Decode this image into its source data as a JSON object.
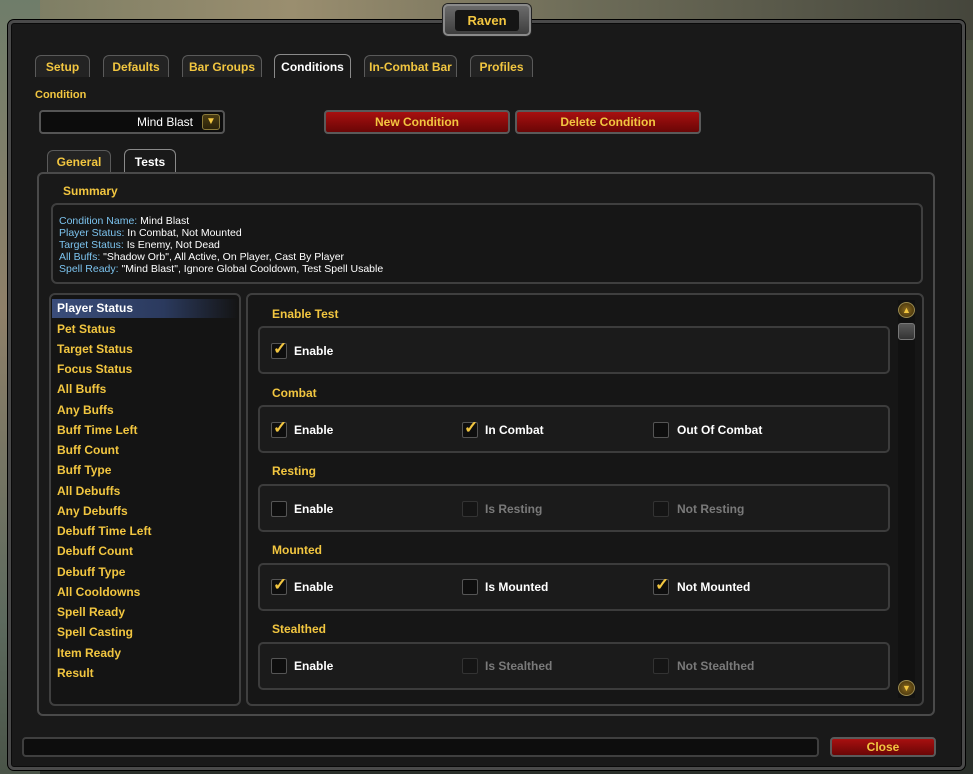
{
  "window": {
    "title": "Raven"
  },
  "tabs": [
    {
      "label": "Setup"
    },
    {
      "label": "Defaults"
    },
    {
      "label": "Bar Groups"
    },
    {
      "label": "Conditions"
    },
    {
      "label": "In-Combat Bar"
    },
    {
      "label": "Profiles"
    }
  ],
  "condition": {
    "label": "Condition",
    "selected": "Mind Blast",
    "new_button": "New Condition",
    "delete_button": "Delete Condition"
  },
  "subtabs": [
    {
      "label": "General"
    },
    {
      "label": "Tests"
    }
  ],
  "summary": {
    "title": "Summary",
    "lines": [
      {
        "key": "Condition Name:",
        "value": " Mind Blast"
      },
      {
        "key": "Player Status:",
        "value": " In Combat, Not Mounted"
      },
      {
        "key": "Target Status:",
        "value": " Is Enemy, Not Dead"
      },
      {
        "key": "All Buffs:",
        "value": " \"Shadow Orb\", All Active, On Player, Cast By Player"
      },
      {
        "key": "Spell Ready:",
        "value": " \"Mind Blast\", Ignore Global Cooldown, Test Spell Usable"
      }
    ]
  },
  "test_list": [
    "Player Status",
    "Pet Status",
    "Target Status",
    "Focus Status",
    "All Buffs",
    "Any Buffs",
    "Buff Time Left",
    "Buff Count",
    "Buff Type",
    "All Debuffs",
    "Any Debuffs",
    "Debuff Time Left",
    "Debuff Count",
    "Debuff Type",
    "All Cooldowns",
    "Spell Ready",
    "Spell Casting",
    "Item Ready",
    "Result"
  ],
  "selected_test": "Player Status",
  "groups": [
    {
      "title": "Enable Test",
      "options": [
        {
          "label": "Enable",
          "checked": true,
          "enabled": true
        }
      ]
    },
    {
      "title": "Combat",
      "options": [
        {
          "label": "Enable",
          "checked": true,
          "enabled": true
        },
        {
          "label": "In Combat",
          "checked": true,
          "enabled": true
        },
        {
          "label": "Out Of Combat",
          "checked": false,
          "enabled": true
        }
      ]
    },
    {
      "title": "Resting",
      "options": [
        {
          "label": "Enable",
          "checked": false,
          "enabled": true
        },
        {
          "label": "Is Resting",
          "checked": false,
          "enabled": false
        },
        {
          "label": "Not Resting",
          "checked": false,
          "enabled": false
        }
      ]
    },
    {
      "title": "Mounted",
      "options": [
        {
          "label": "Enable",
          "checked": true,
          "enabled": true
        },
        {
          "label": "Is Mounted",
          "checked": false,
          "enabled": true
        },
        {
          "label": "Not Mounted",
          "checked": true,
          "enabled": true
        }
      ]
    },
    {
      "title": "Stealthed",
      "options": [
        {
          "label": "Enable",
          "checked": false,
          "enabled": true
        },
        {
          "label": "Is Stealthed",
          "checked": false,
          "enabled": false
        },
        {
          "label": "Not Stealthed",
          "checked": false,
          "enabled": false
        }
      ]
    }
  ],
  "footer": {
    "close_button": "Close"
  },
  "colors": {
    "gold": "#f2c640",
    "summary_key": "#7cc3ee",
    "button_red": "#a81010",
    "selection": "#3a4d7a"
  },
  "icons": {
    "dropdown": "chevron-down-icon",
    "scroll_up": "scroll-up-icon",
    "scroll_down": "scroll-down-icon",
    "check": "checkmark-icon"
  }
}
